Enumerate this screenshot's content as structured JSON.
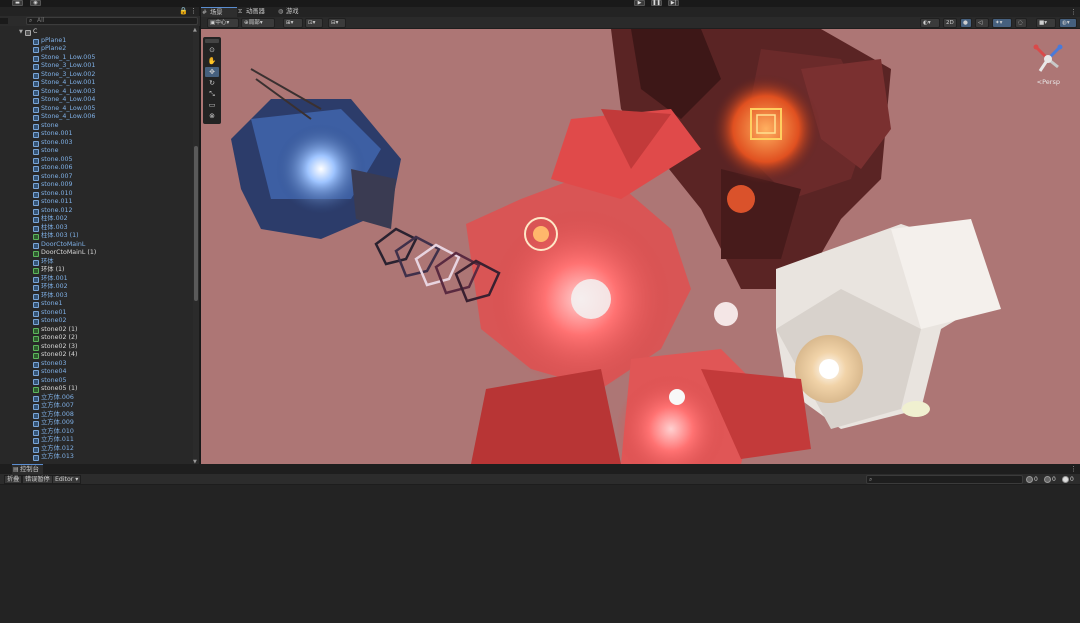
{
  "top_bar": {
    "left_icons": [
      "layers-icon",
      "account-icon"
    ],
    "center_icons": [
      "play-icon",
      "pause-icon",
      "step-icon"
    ]
  },
  "hierarchy": {
    "search_placeholder": "All",
    "root_label": "C",
    "items": [
      {
        "label": "pPlane1",
        "prefab": false
      },
      {
        "label": "pPlane2",
        "prefab": false
      },
      {
        "label": "Stone_1_Low.005",
        "prefab": false
      },
      {
        "label": "Stone_3_Low.001",
        "prefab": false
      },
      {
        "label": "Stone_3_Low.002",
        "prefab": false
      },
      {
        "label": "Stone_4_Low.001",
        "prefab": false
      },
      {
        "label": "Stone_4_Low.003",
        "prefab": false
      },
      {
        "label": "Stone_4_Low.004",
        "prefab": false
      },
      {
        "label": "Stone_4_Low.005",
        "prefab": false
      },
      {
        "label": "Stone_4_Low.006",
        "prefab": false
      },
      {
        "label": "stone",
        "prefab": false
      },
      {
        "label": "stone.001",
        "prefab": false
      },
      {
        "label": "stone.003",
        "prefab": false
      },
      {
        "label": "stone",
        "prefab": false
      },
      {
        "label": "stone.005",
        "prefab": false
      },
      {
        "label": "stone.006",
        "prefab": false
      },
      {
        "label": "stone.007",
        "prefab": false
      },
      {
        "label": "stone.009",
        "prefab": false
      },
      {
        "label": "stone.010",
        "prefab": false
      },
      {
        "label": "stone.011",
        "prefab": false
      },
      {
        "label": "stone.012",
        "prefab": false
      },
      {
        "label": "柱体.002",
        "prefab": false
      },
      {
        "label": "柱体.003",
        "prefab": false
      },
      {
        "label": "柱体.003 (1)",
        "prefab": true
      },
      {
        "label": "DoorCtoMainL",
        "prefab": false
      },
      {
        "label": "DoorCtoMainL (1)",
        "prefab": true,
        "white": true
      },
      {
        "label": "环体",
        "prefab": false
      },
      {
        "label": "环体 (1)",
        "prefab": true,
        "white": true
      },
      {
        "label": "环体.001",
        "prefab": false
      },
      {
        "label": "环体.002",
        "prefab": false
      },
      {
        "label": "环体.003",
        "prefab": false
      },
      {
        "label": "stone1",
        "prefab": false
      },
      {
        "label": "stone01",
        "prefab": false
      },
      {
        "label": "stone02",
        "prefab": false
      },
      {
        "label": "stone02 (1)",
        "prefab": true,
        "white": true
      },
      {
        "label": "stone02 (2)",
        "prefab": true,
        "white": true
      },
      {
        "label": "stone02 (3)",
        "prefab": true,
        "white": true
      },
      {
        "label": "stone02 (4)",
        "prefab": true,
        "white": true
      },
      {
        "label": "stone03",
        "prefab": false
      },
      {
        "label": "stone04",
        "prefab": false
      },
      {
        "label": "stone05",
        "prefab": false
      },
      {
        "label": "stone05 (1)",
        "prefab": true,
        "white": true
      },
      {
        "label": "立方体.006",
        "prefab": false
      },
      {
        "label": "立方体.007",
        "prefab": false
      },
      {
        "label": "立方体.008",
        "prefab": false
      },
      {
        "label": "立方体.009",
        "prefab": false
      },
      {
        "label": "立方体.010",
        "prefab": false
      },
      {
        "label": "立方体.011",
        "prefab": false
      },
      {
        "label": "立方体.012",
        "prefab": false
      },
      {
        "label": "立方体.013",
        "prefab": false
      }
    ]
  },
  "scene": {
    "tabs": [
      {
        "label": "场景",
        "icon": "hash-icon",
        "active": true
      },
      {
        "label": "动画器",
        "icon": "animator-icon",
        "active": false
      },
      {
        "label": "游戏",
        "icon": "gamepad-icon",
        "active": false
      }
    ],
    "toolbar": {
      "pivot_label": "中心",
      "space_label": "局部",
      "mode_2d_label": "2D",
      "persp_label": "<Persp"
    },
    "colors": {
      "scene_bg": "#ad7675",
      "blue_island": "#3a5d9c",
      "red_glow": "#ff5a5a",
      "white_structure": "#e8e2dc",
      "dark_red": "#5a2020"
    }
  },
  "console": {
    "tab_label": "控制台",
    "clear_label": "折叠",
    "error_pause_label": "错误暂停",
    "editor_label": "Editor",
    "counts": {
      "log": "0",
      "warn": "0",
      "error": "0"
    }
  }
}
